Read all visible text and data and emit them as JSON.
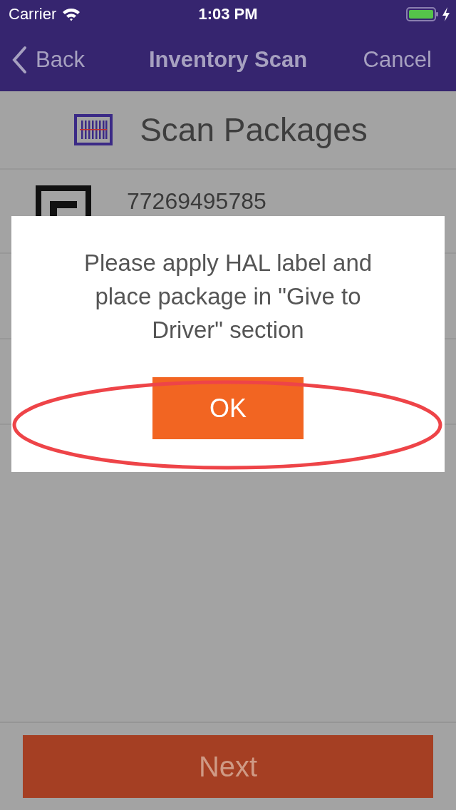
{
  "status_bar": {
    "carrier": "Carrier",
    "time": "1:03 PM",
    "charging": true
  },
  "nav": {
    "back": "Back",
    "title": "Inventory Scan",
    "cancel": "Cancel"
  },
  "header": {
    "title": "Scan Packages"
  },
  "packages": [
    {
      "number": "77269495785"
    }
  ],
  "dialog": {
    "message": "Please apply HAL label and place package in \"Give to Driver\" section",
    "button": "OK",
    "highlighted": true
  },
  "footer": {
    "button": "Next"
  }
}
